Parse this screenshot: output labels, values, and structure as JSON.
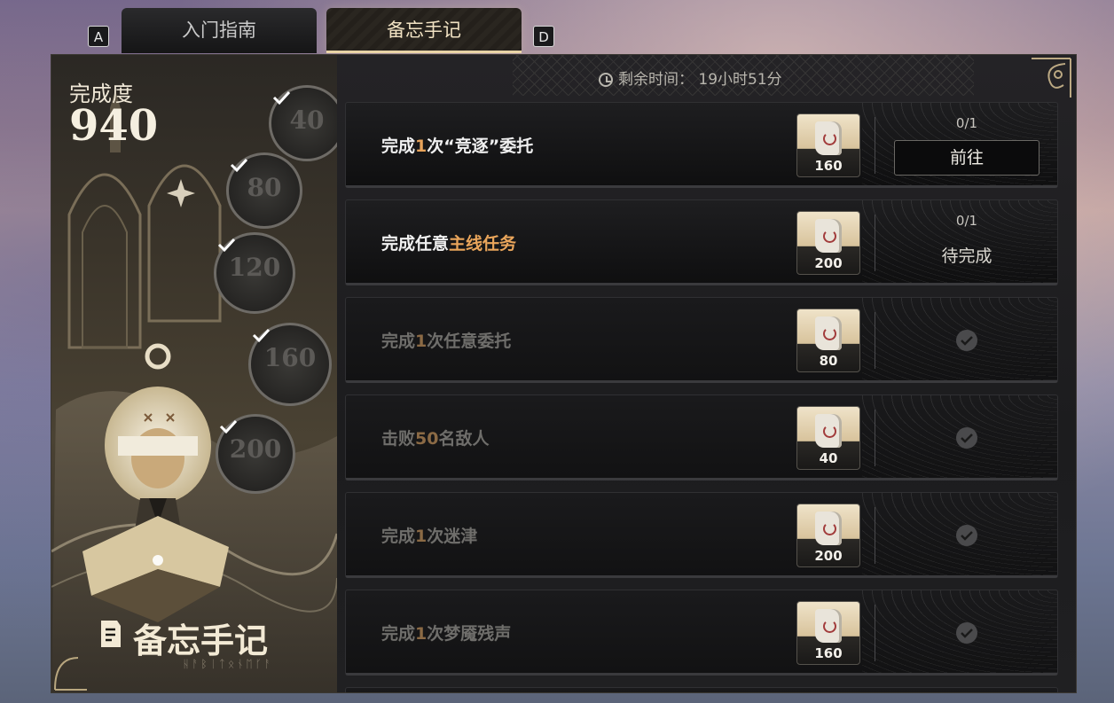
{
  "tabs": {
    "left_key": "A",
    "right_key": "D",
    "items": [
      {
        "label": "入门指南",
        "active": false
      },
      {
        "label": "备忘手记",
        "active": true
      }
    ]
  },
  "progress_panel": {
    "label": "完成度",
    "score": "940",
    "milestones": [
      {
        "value": "40",
        "claimed": true
      },
      {
        "value": "80",
        "claimed": true
      },
      {
        "value": "120",
        "claimed": true
      },
      {
        "value": "160",
        "claimed": true
      },
      {
        "value": "200",
        "claimed": true
      }
    ],
    "brand_title": "备忘手记",
    "brand_subtitle": "ᚺᚨᛒᛁᛏᛟᚾᛖᚴᚨ"
  },
  "timer": {
    "label": "剩余时间：",
    "value": "19小时51分"
  },
  "tasks": [
    {
      "title_pre": "完成",
      "title_num": "1",
      "title_post": "次“竞逐”委托",
      "title_hl": "",
      "reward": "160",
      "progress": "0/1",
      "status": "go",
      "button_label": "前往"
    },
    {
      "title_pre": "完成任意",
      "title_num": "",
      "title_post": "",
      "title_hl": "主线任务",
      "reward": "200",
      "progress": "0/1",
      "status": "pending",
      "button_label": "待完成"
    },
    {
      "title_pre": "完成",
      "title_num": "1",
      "title_post": "次任意委托",
      "title_hl": "",
      "reward": "80",
      "progress": "",
      "status": "done",
      "button_label": ""
    },
    {
      "title_pre": "击败",
      "title_num": "50",
      "title_post": "名敌人",
      "title_hl": "",
      "reward": "40",
      "progress": "",
      "status": "done",
      "button_label": ""
    },
    {
      "title_pre": "完成",
      "title_num": "1",
      "title_post": "次迷津",
      "title_hl": "",
      "reward": "200",
      "progress": "",
      "status": "done",
      "button_label": ""
    },
    {
      "title_pre": "完成",
      "title_num": "1",
      "title_post": "次梦魇残声",
      "title_hl": "",
      "reward": "160",
      "progress": "",
      "status": "done",
      "button_label": ""
    }
  ]
}
